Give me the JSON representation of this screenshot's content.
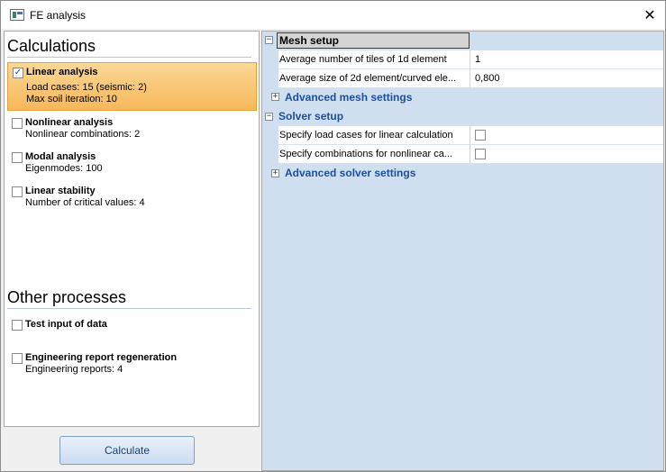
{
  "window": {
    "title": "FE analysis",
    "close_glyph": "✕"
  },
  "left": {
    "calculations_title": "Calculations",
    "calculations": [
      {
        "title": "Linear analysis",
        "lines": [
          "Load cases: 15 (seismic: 2)",
          "Max soil iteration: 10"
        ],
        "checked": true,
        "selected": true
      },
      {
        "title": "Nonlinear analysis",
        "lines": [
          "Nonlinear combinations: 2"
        ],
        "checked": false,
        "selected": false
      },
      {
        "title": "Modal analysis",
        "lines": [
          "Eigenmodes: 100"
        ],
        "checked": false,
        "selected": false
      },
      {
        "title": "Linear stability",
        "lines": [
          "Number of critical values: 4"
        ],
        "checked": false,
        "selected": false
      }
    ],
    "other_title": "Other processes",
    "other": [
      {
        "title": "Test input of data",
        "lines": [],
        "checked": false
      },
      {
        "title": "Engineering report regeneration",
        "lines": [
          "Engineering reports: 4"
        ],
        "checked": false
      }
    ],
    "calculate_label": "Calculate"
  },
  "right": {
    "mesh_setup": "Mesh setup",
    "mesh_rows": [
      {
        "label": "Average number of tiles of 1d element",
        "value": "1"
      },
      {
        "label": "Average size of 2d element/curved ele...",
        "value": "0,800"
      }
    ],
    "advanced_mesh": "Advanced mesh settings",
    "solver_setup": "Solver setup",
    "solver_rows": [
      {
        "label": "Specify load cases for linear calculation"
      },
      {
        "label": "Specify combinations for nonlinear ca..."
      }
    ],
    "advanced_solver": "Advanced solver settings",
    "collapse_glyph": "−",
    "expand_glyph": "+"
  },
  "colors": {
    "accent": "#1c4f9c",
    "selected_bg": "#f7b75a",
    "panel_bg": "#cfdff0"
  }
}
